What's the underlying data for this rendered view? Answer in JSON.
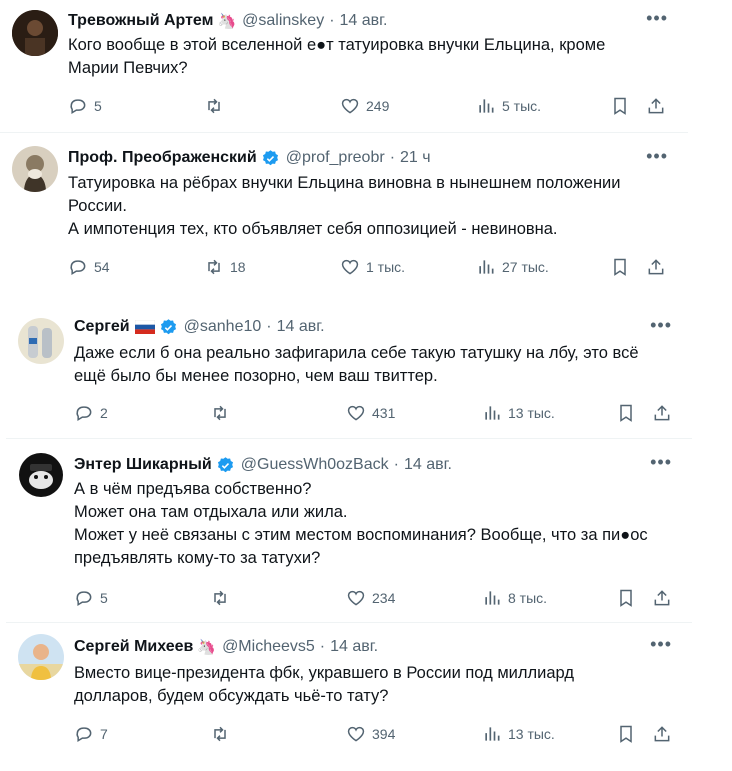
{
  "tweets": [
    {
      "name": "Тревожный Артем",
      "emoji": "🦄",
      "handle": "@salinskey",
      "time": "14 авг.",
      "lines": [
        "Кого вообще в этой вселенной е●т татуировка внучки Ельцина, кроме",
        "Марии Певчих?"
      ],
      "replies": "5",
      "retweets": "",
      "likes": "249",
      "views": "5 тыс.",
      "avatar_color": "#3b2b1f",
      "verified": false
    },
    {
      "name": "Проф. Преображенский",
      "emoji": "",
      "handle": "@prof_preobr",
      "time": "21 ч",
      "lines": [
        "Татуировка на рёбрах внучки Ельцина виновна в нынешнем положении",
        "России.",
        "А импотенция тех, кто объявляет себя оппозицией - невиновна."
      ],
      "replies": "54",
      "retweets": "18",
      "likes": "1 тыс.",
      "views": "27 тыс.",
      "avatar_color": "#7a6a55",
      "verified": true
    },
    {
      "name": "Сергей",
      "emoji": "",
      "handle": "@sanhe10",
      "time": "14 авг.",
      "lines": [
        "Даже если б она реально зафигарила себе такую татушку на лбу, это всё",
        "ещё было бы менее позорно, чем ваш твиттер."
      ],
      "replies": "2",
      "retweets": "",
      "likes": "431",
      "views": "13 тыс.",
      "avatar_color": "#cfc6a8",
      "verified": true
    },
    {
      "name": "Энтер Шикарный",
      "emoji": "",
      "handle": "@GuessWh0ozBack",
      "time": "14 авг.",
      "lines": [
        "А в чём предъява собственно?",
        "Может она там отдыхала или жила.",
        "Может у неё связаны с этим местом воспоминания? Вообще, что за пи●ос",
        "предъявлять кому-то за татухи?"
      ],
      "replies": "5",
      "retweets": "",
      "likes": "234",
      "views": "8 тыс.",
      "avatar_color": "#111111",
      "verified": true
    },
    {
      "name": "Сергей Михеев",
      "emoji": "🦄",
      "handle": "@Micheevs5",
      "time": "14 авг.",
      "lines": [
        "Вместо вице-президента фбк, укравшего в России под миллиард",
        "долларов, будем обсуждать чьё-то тату?"
      ],
      "replies": "7",
      "retweets": "",
      "likes": "394",
      "views": "13 тыс.",
      "avatar_color": "#e9c27a",
      "verified": false
    }
  ],
  "colors": {
    "accent": "#1d9bf0",
    "muted": "#536471",
    "divider": "#eff3f4"
  }
}
